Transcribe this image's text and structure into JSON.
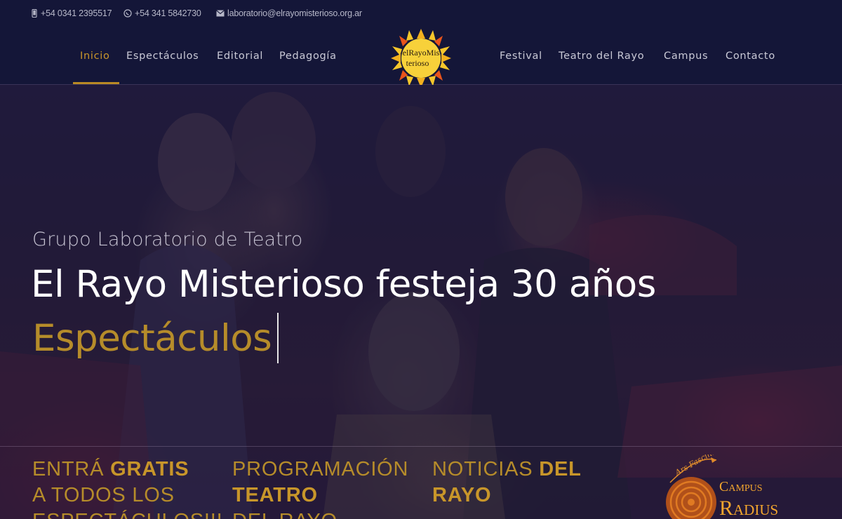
{
  "contact": {
    "phone": "+54 0341 2395517",
    "whatsapp": "+54 341 5842730",
    "email": "laboratorio@elrayomisterioso.org.ar"
  },
  "nav": {
    "left": [
      "Inicio",
      "Espectáculos",
      "Editorial",
      "Pedagogía"
    ],
    "right": [
      "Festival",
      "Teatro del Rayo",
      "Campus",
      "Contacto"
    ],
    "active": "Inicio"
  },
  "logo": {
    "lines": [
      "elRayoMis",
      "terioso"
    ]
  },
  "hero": {
    "subtitle": "Grupo Laboratorio de Teatro",
    "title": "El Rayo Misterioso festeja 30 años",
    "typed": "Espectáculos"
  },
  "cards": [
    {
      "plain1": "ENTRÁ ",
      "bold1": "GRATIS",
      "rest": "A TODOS LOS",
      "rest2": "ESPECTÁCULOS!!!"
    },
    {
      "plain1": "PROGRAMACIÓN",
      "bold1": "TEATRO",
      "rest": "DEL RAYO"
    },
    {
      "plain1": "NOTICIAS ",
      "bold1": "DEL",
      "rest": "RAYO"
    }
  ],
  "campus": {
    "line1": "Campus",
    "line2": "Radius",
    "motto": "Ars Fascinans Artis"
  },
  "colors": {
    "navy": "#141638",
    "gold": "#b68c2a",
    "white": "#ffffff"
  }
}
